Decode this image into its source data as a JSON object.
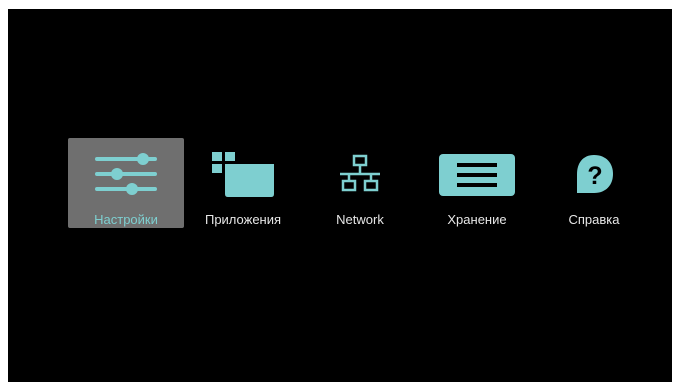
{
  "colors": {
    "accent": "#7ecfd0",
    "background": "#000000",
    "selected_bg": "#6f6f6f",
    "label_text": "#e6e6e6"
  },
  "menu": {
    "selected_index": 0,
    "items": [
      {
        "label": "Настройки",
        "icon": "settings-sliders-icon"
      },
      {
        "label": "Приложения",
        "icon": "apps-icon"
      },
      {
        "label": "Network",
        "icon": "network-icon"
      },
      {
        "label": "Хранение",
        "icon": "storage-icon"
      },
      {
        "label": "Справка",
        "icon": "help-icon"
      }
    ]
  }
}
